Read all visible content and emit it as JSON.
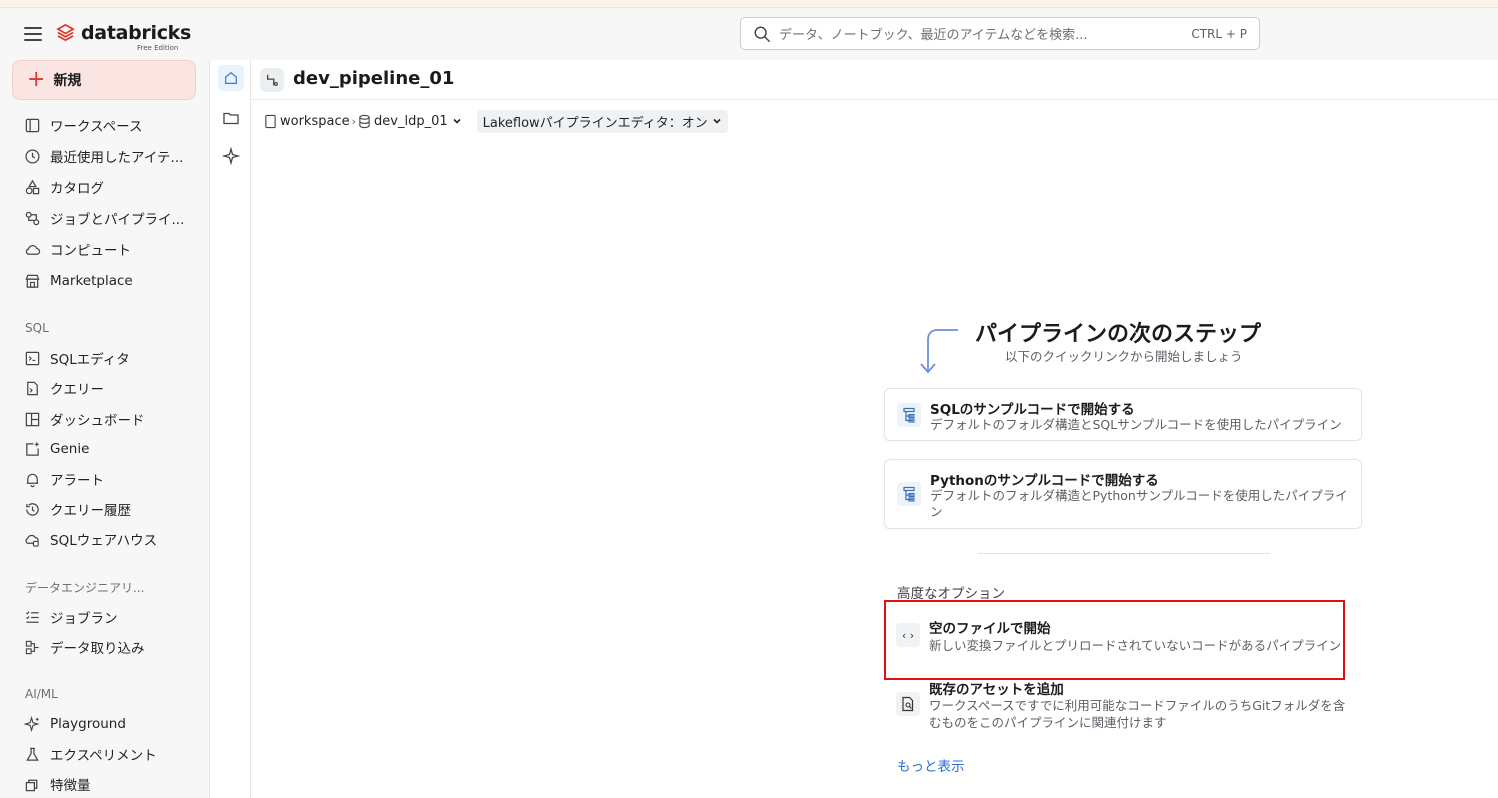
{
  "topbar": {
    "logo_text": "databricks",
    "logo_sub": "Free Edition",
    "search_placeholder": "データ、ノートブック、最近のアイテムなどを検索...",
    "search_shortcut": "CTRL + P"
  },
  "sidebar": {
    "new_label": "新規",
    "items_main": [
      {
        "label": "ワークスペース",
        "icon": "workspace-icon"
      },
      {
        "label": "最近使用したアイテ...",
        "icon": "clock-icon"
      },
      {
        "label": "カタログ",
        "icon": "catalog-icon"
      },
      {
        "label": "ジョブとパイプライ...",
        "icon": "jobs-icon"
      },
      {
        "label": "コンピュート",
        "icon": "cloud-icon"
      },
      {
        "label": "Marketplace",
        "icon": "store-icon"
      }
    ],
    "section_sql": "SQL",
    "items_sql": [
      {
        "label": "SQLエディタ",
        "icon": "sql-editor-icon"
      },
      {
        "label": "クエリー",
        "icon": "query-icon"
      },
      {
        "label": "ダッシュボード",
        "icon": "dashboard-icon"
      },
      {
        "label": "Genie",
        "icon": "genie-icon"
      },
      {
        "label": "アラート",
        "icon": "bell-icon"
      },
      {
        "label": "クエリー履歴",
        "icon": "history-icon"
      },
      {
        "label": "SQLウェアハウス",
        "icon": "warehouse-icon"
      }
    ],
    "section_de": "データエンジニアリ...",
    "items_de": [
      {
        "label": "ジョブラン",
        "icon": "job-runs-icon"
      },
      {
        "label": "データ取り込み",
        "icon": "ingest-icon"
      }
    ],
    "section_ml": "AI/ML",
    "items_ml": [
      {
        "label": "Playground",
        "icon": "sparkle-icon"
      },
      {
        "label": "エクスペリメント",
        "icon": "flask-icon"
      },
      {
        "label": "特徴量",
        "icon": "features-icon"
      }
    ]
  },
  "header": {
    "title": "dev_pipeline_01"
  },
  "breadcrumb": {
    "workspace": "workspace",
    "separator": "›",
    "schema": "dev_ldp_01",
    "editor_toggle": "Lakeflowパイプラインエディタ：オン"
  },
  "panel": {
    "title": "パイプラインの次のステップ",
    "subtitle": "以下のクイックリンクから開始しましょう",
    "cards": [
      {
        "title": "SQLのサンプルコードで開始する",
        "desc": "デフォルトのフォルダ構造とSQLサンプルコードを使用したパイプライン"
      },
      {
        "title": "Pythonのサンプルコードで開始する",
        "desc": "デフォルトのフォルダ構造とPythonサンプルコードを使用したパイプライン"
      }
    ],
    "advanced_label": "高度なオプション",
    "options": [
      {
        "title": "空のファイルで開始",
        "desc": "新しい変換ファイルとプリロードされていないコードがあるパイプライン",
        "icon_text": "‹ ›"
      },
      {
        "title": "既存のアセットを追加",
        "desc": "ワークスペースですでに利用可能なコードファイルのうちGitフォルダを含むものをこのパイプラインに関連付けます"
      }
    ],
    "more_link": "もっと表示"
  },
  "colors": {
    "accent_red": "#e0362c",
    "highlight_box": "#e01010",
    "link_blue": "#2a6fd1"
  }
}
